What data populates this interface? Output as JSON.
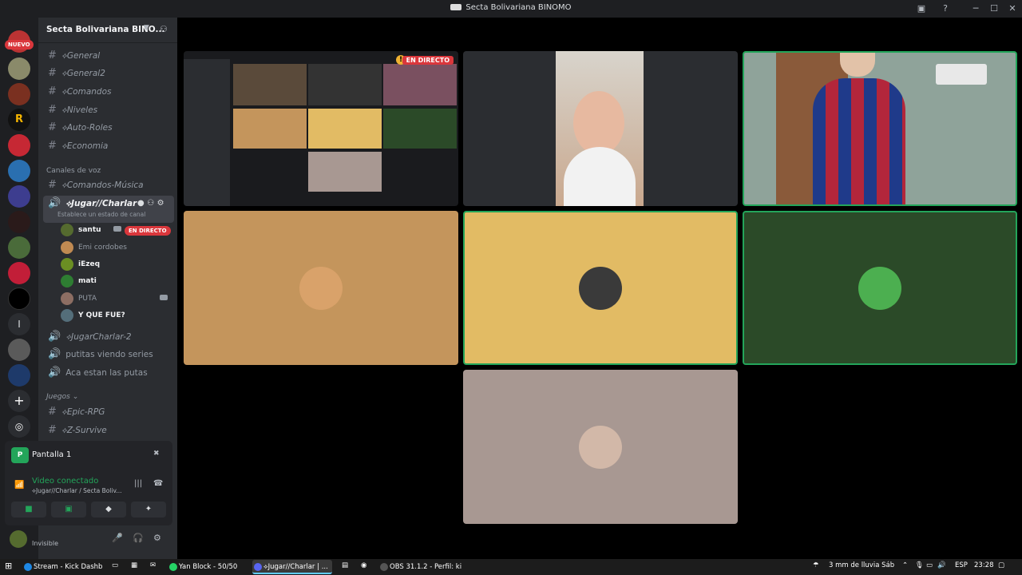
{
  "window": {
    "title": "Secta Bolivariana BINOMO"
  },
  "servers": {
    "new_badge": "NUEVO"
  },
  "guild": {
    "name": "Secta Bolivariana BINO..."
  },
  "channels": {
    "text": [
      "⟡General",
      "⟡General2",
      "⟡Comandos",
      "⟡Niveles",
      "⟡Auto-Roles",
      "⟡Economia"
    ],
    "voice_category": "Canales de voz",
    "voice_first": "⟡Comandos-Música",
    "active_voice": "⟡Jugar//Charlar",
    "active_voice_status": "Establece un estado de canal",
    "members": [
      {
        "name": "santu",
        "live": "EN DIRECTO",
        "color": "#556b2f"
      },
      {
        "name": "Emi cordobes",
        "color": "#c08a52"
      },
      {
        "name": "iEzeq",
        "color": "#6b8e23"
      },
      {
        "name": "mati",
        "color": "#2e7d32"
      },
      {
        "name": "PUTA",
        "color": "#8d6e63"
      },
      {
        "name": "Y QUE FUE?",
        "color": "#546e7a"
      }
    ],
    "voice_rest": [
      "⟡JugarCharlar-2",
      "putitas viendo series",
      "Aca estan las putas"
    ],
    "games_category": "Juegos",
    "games": [
      "⟡Epic-RPG",
      "⟡Z-Survive"
    ]
  },
  "panel": {
    "screen_label": "Pantalla 1",
    "connection": "Video conectado",
    "connection_sub": "⟡Jugar//Charlar / Secta Boliv..."
  },
  "user": {
    "status": "Invisible"
  },
  "stage": {
    "live_tag": "EN DIRECTO",
    "tiles": [
      {
        "id": "stream",
        "bg": "#1a1b1e"
      },
      {
        "id": "cam-girl",
        "bg": "#2b2d31"
      },
      {
        "id": "cam-boy",
        "bg": "#8fa39a"
      },
      {
        "id": "avatar-orange",
        "bg": "#c4955c"
      },
      {
        "id": "avatar-yellow",
        "bg": "#e2bb64"
      },
      {
        "id": "avatar-green",
        "bg": "#2b4a28"
      },
      {
        "id": "avatar-grey",
        "bg": "#a89892"
      }
    ]
  },
  "taskbar": {
    "tasks": [
      {
        "label": "Stream - Kick Dashb...",
        "color": "#1e88e5"
      },
      {
        "label": "Yan Block - 50/50",
        "color": "#25d366"
      },
      {
        "label": "⟡Jugar//Charlar | ...",
        "color": "#5865f2"
      },
      {
        "label": "OBS 31.1.2 - Perfil: ki...",
        "color": "#555555"
      }
    ],
    "weather": "3 mm de lluvia Sáb",
    "lang": "ESP",
    "time": "23:28"
  }
}
